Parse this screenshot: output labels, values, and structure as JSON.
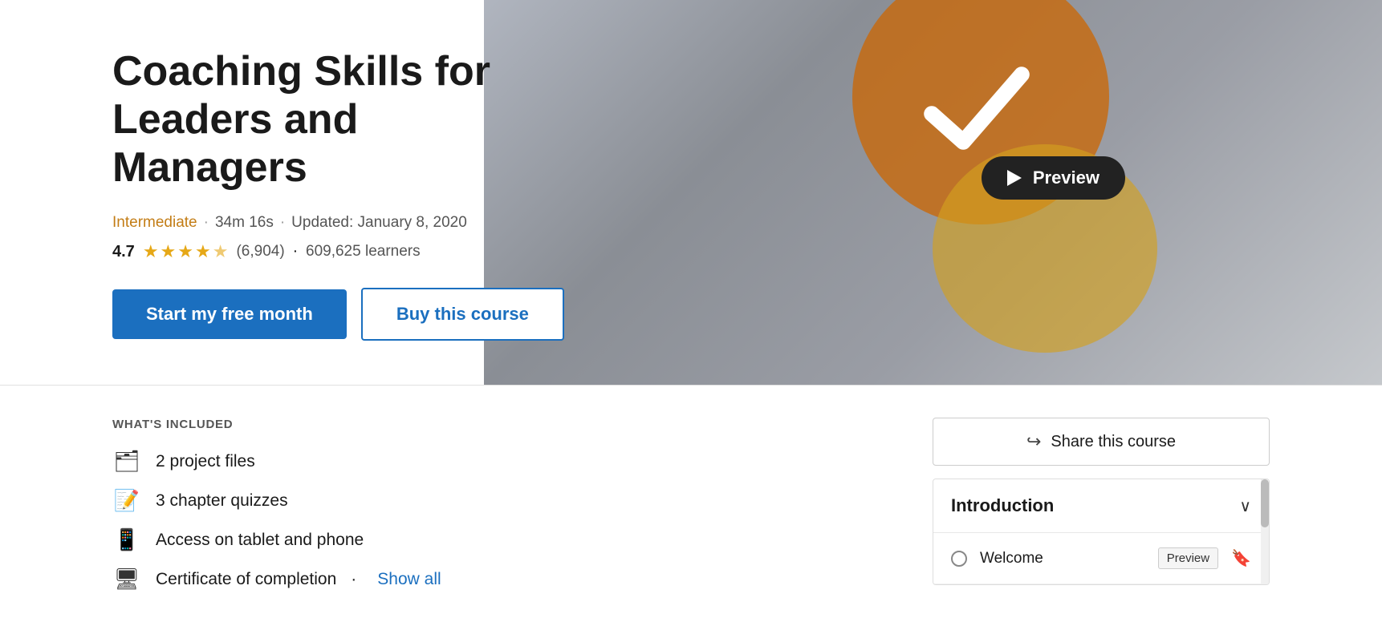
{
  "hero": {
    "title_line1": "Coaching Skills for Leaders and",
    "title_line2": "Managers",
    "level": "Intermediate",
    "duration": "34m 16s",
    "updated": "Updated: January 8, 2020",
    "rating": "4.7",
    "rating_count": "(6,904)",
    "learners": "609,625 learners",
    "btn_primary": "Start my free month",
    "btn_secondary": "Buy this course",
    "preview_label": "Preview"
  },
  "whats_included": {
    "section_label": "WHAT'S INCLUDED",
    "items": [
      {
        "icon": "📁",
        "text": "2 project files"
      },
      {
        "icon": "📝",
        "text": "3 chapter quizzes"
      },
      {
        "icon": "📱",
        "text": "Access on tablet and phone"
      },
      {
        "icon": "🖥",
        "text": "Certificate of completion"
      }
    ],
    "show_all": "Show all"
  },
  "right_panel": {
    "share_label": "Share this course",
    "contents_title": "Introduction",
    "contents_items": [
      {
        "title": "Welcome",
        "preview": "Preview"
      }
    ]
  }
}
